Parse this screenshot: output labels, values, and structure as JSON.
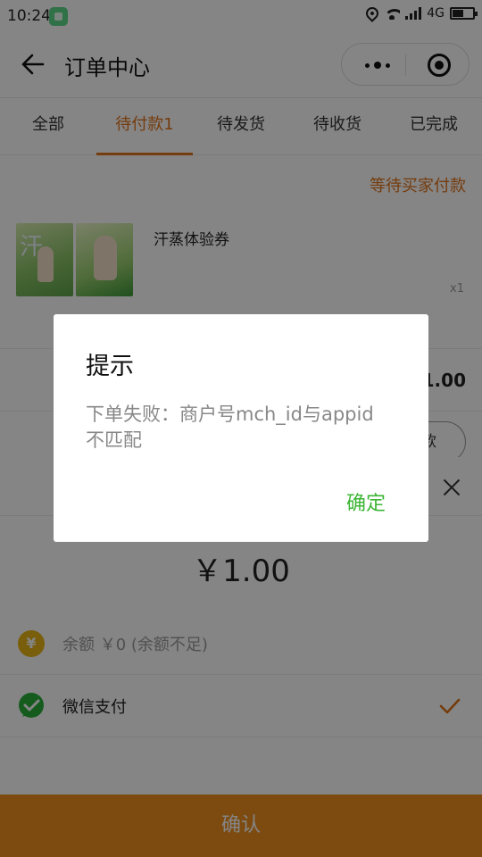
{
  "status_bar": {
    "time": "10:24",
    "network": "4G"
  },
  "nav": {
    "title": "订单中心"
  },
  "tabs": [
    {
      "label": "全部"
    },
    {
      "label": "待付款1"
    },
    {
      "label": "待发货"
    },
    {
      "label": "待收货"
    },
    {
      "label": "已完成"
    }
  ],
  "order": {
    "status": "等待买家付款",
    "product_name": "汗蒸体验券",
    "image_text": "汗",
    "quantity": "x1",
    "total": "1.00",
    "pay_button": "付款"
  },
  "sheet": {
    "amount": "￥1.00",
    "balance_icon": "¥",
    "balance_label": "余额 ￥0 (余额不足)",
    "wechat_label": "微信支付",
    "confirm_label": "确认"
  },
  "dialog": {
    "title": "提示",
    "message": "下单失败：商户号mch_id与appid不匹配",
    "ok_label": "确定"
  },
  "colors": {
    "accent": "#e0731a",
    "confirm": "#f0911f",
    "wechat_green": "#3cb534",
    "coin": "#e8b516"
  }
}
